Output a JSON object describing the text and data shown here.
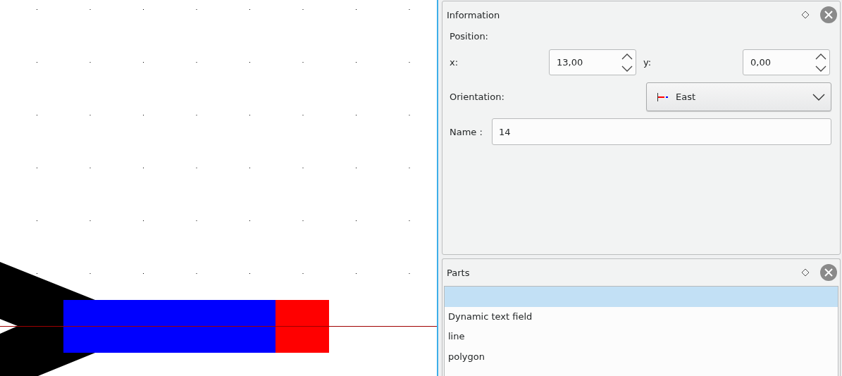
{
  "information": {
    "title": "Information",
    "position_label": "Position:",
    "x_label": "x:",
    "x_value": "13,00",
    "y_label": "y:",
    "y_value": "0,00",
    "orientation_label": "Orientation:",
    "orientation_value": "East",
    "name_label": "Name :",
    "name_value": "14"
  },
  "parts": {
    "title": "Parts",
    "items": [
      {
        "selected": true
      },
      {
        "label": "Dynamic text field",
        "selected": false
      },
      {
        "label": "line",
        "selected": false
      },
      {
        "label": "polygon",
        "selected": false
      }
    ]
  }
}
